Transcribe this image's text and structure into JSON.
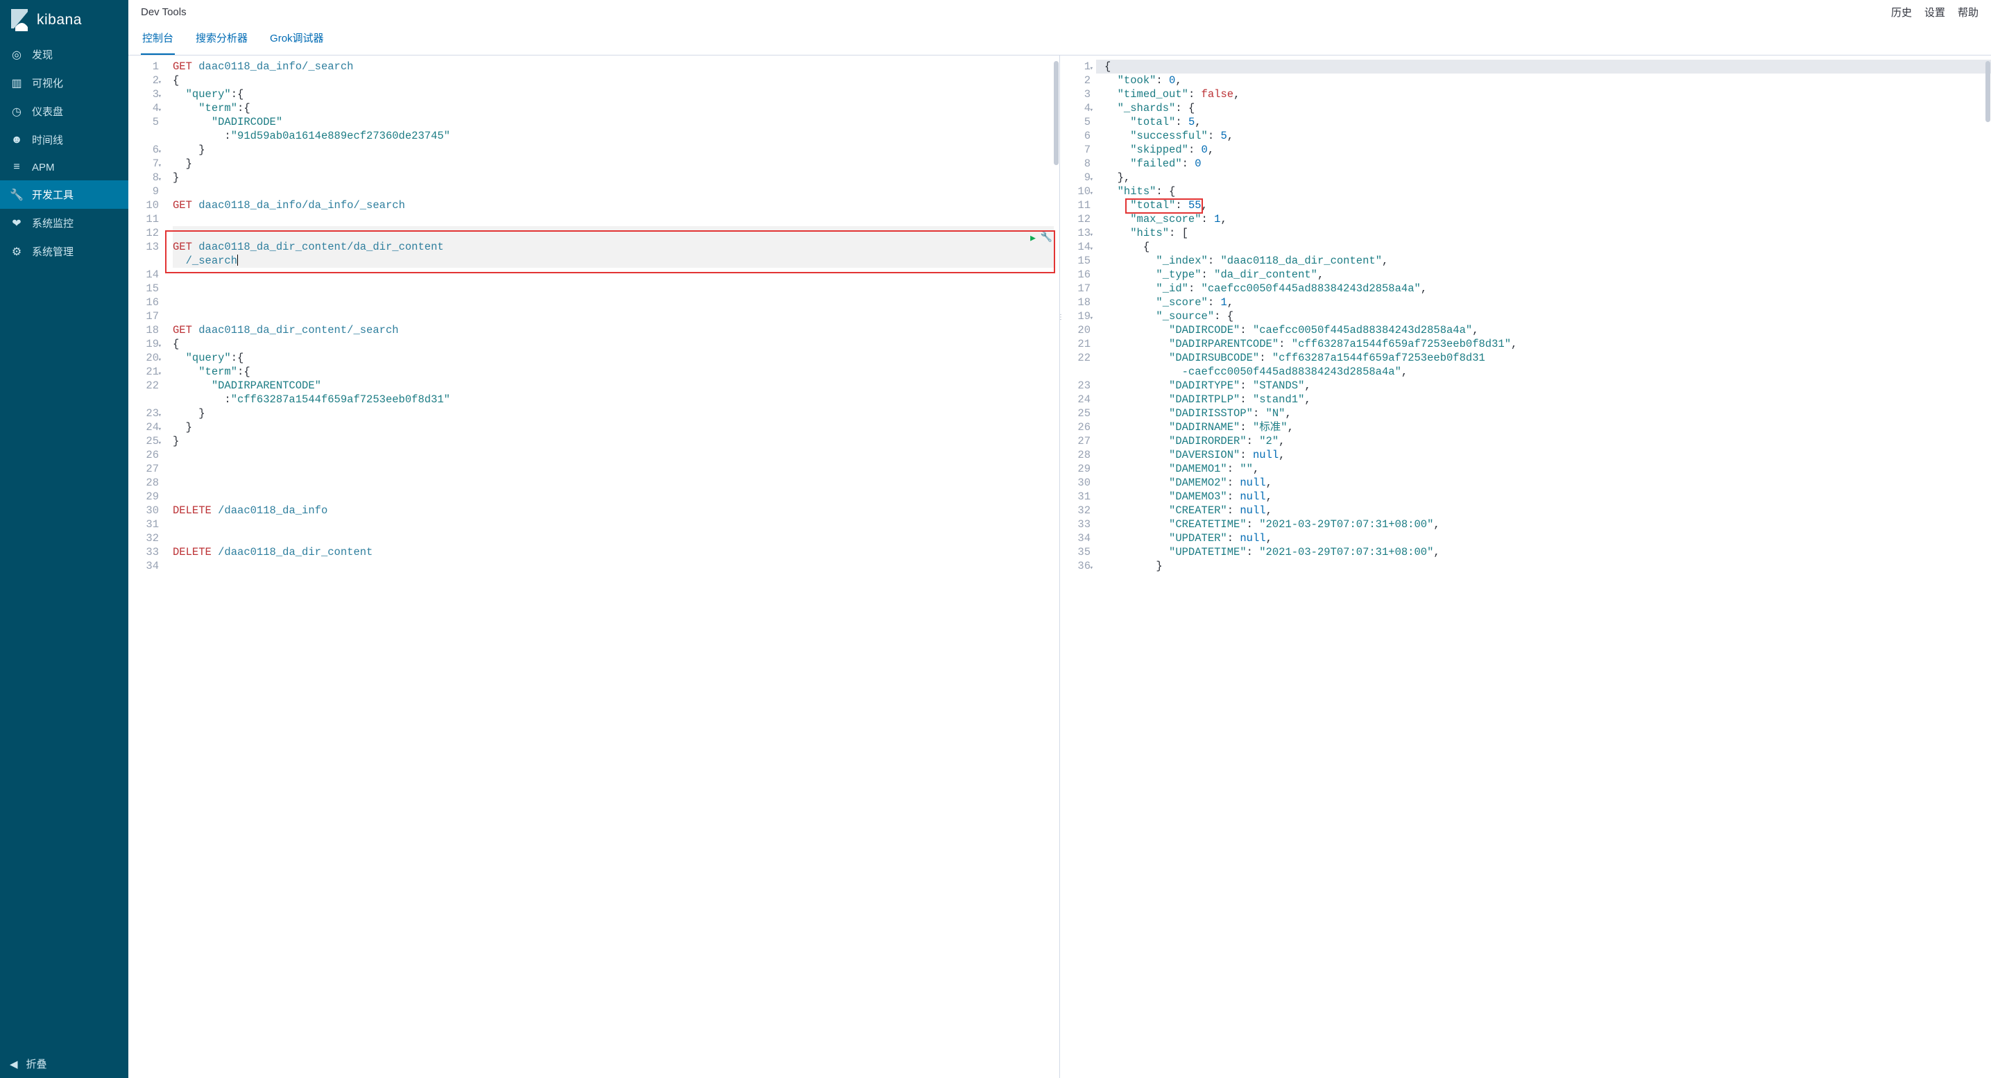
{
  "app_name": "kibana",
  "header": {
    "title": "Dev Tools"
  },
  "header_links": {
    "history": "历史",
    "settings": "设置",
    "help": "帮助"
  },
  "sidebar": {
    "items": [
      {
        "icon": "compass-icon",
        "label": "发现"
      },
      {
        "icon": "barchart-icon",
        "label": "可视化"
      },
      {
        "icon": "gauge-icon",
        "label": "仪表盘"
      },
      {
        "icon": "bear-icon",
        "label": "时间线"
      },
      {
        "icon": "apm-icon",
        "label": "APM"
      },
      {
        "icon": "wrench-icon",
        "label": "开发工具"
      },
      {
        "icon": "heartbeat-icon",
        "label": "系统监控"
      },
      {
        "icon": "gear-icon",
        "label": "系统管理"
      }
    ],
    "collapse_label": "折叠"
  },
  "tabs": [
    {
      "label": "控制台",
      "active": true
    },
    {
      "label": "搜索分析器",
      "active": false
    },
    {
      "label": "Grok调试器",
      "active": false
    }
  ],
  "editor": {
    "lines": [
      {
        "n": 1,
        "fold": false,
        "type": "req",
        "method": "GET",
        "path": "daac0118_da_info/_search"
      },
      {
        "n": 2,
        "fold": true,
        "type": "text",
        "text": "{"
      },
      {
        "n": 3,
        "fold": true,
        "type": "text",
        "text": "  \"query\":{"
      },
      {
        "n": 4,
        "fold": true,
        "type": "text",
        "text": "    \"term\":{"
      },
      {
        "n": 5,
        "fold": false,
        "type": "kv",
        "text": "      \"DADIRCODE\""
      },
      {
        "n": "",
        "fold": false,
        "type": "cont",
        "text": "        :\"91d59ab0a1614e889ecf27360de23745\""
      },
      {
        "n": 6,
        "fold": true,
        "type": "text",
        "text": "    }"
      },
      {
        "n": 7,
        "fold": true,
        "type": "text",
        "text": "  }"
      },
      {
        "n": 8,
        "fold": true,
        "type": "text",
        "text": "}"
      },
      {
        "n": 9,
        "fold": false,
        "type": "blank",
        "text": ""
      },
      {
        "n": 10,
        "fold": false,
        "type": "req",
        "method": "GET",
        "path": "daac0118_da_info/da_info/_search"
      },
      {
        "n": 11,
        "fold": false,
        "type": "blank",
        "text": ""
      },
      {
        "n": 12,
        "fold": false,
        "type": "blank",
        "text": "",
        "hl": true
      },
      {
        "n": 13,
        "fold": false,
        "type": "req",
        "method": "GET",
        "path": "daac0118_da_dir_content/da_dir_content",
        "hl": true
      },
      {
        "n": "",
        "fold": false,
        "type": "pathcont",
        "text": "/_search",
        "hl": true,
        "caret": true
      },
      {
        "n": 14,
        "fold": false,
        "type": "blank",
        "text": ""
      },
      {
        "n": 15,
        "fold": false,
        "type": "blank",
        "text": ""
      },
      {
        "n": 16,
        "fold": false,
        "type": "blank",
        "text": ""
      },
      {
        "n": 17,
        "fold": false,
        "type": "blank",
        "text": ""
      },
      {
        "n": 18,
        "fold": false,
        "type": "req",
        "method": "GET",
        "path": "daac0118_da_dir_content/_search"
      },
      {
        "n": 19,
        "fold": true,
        "type": "text",
        "text": "{"
      },
      {
        "n": 20,
        "fold": true,
        "type": "text",
        "text": "  \"query\":{"
      },
      {
        "n": 21,
        "fold": true,
        "type": "text",
        "text": "    \"term\":{"
      },
      {
        "n": 22,
        "fold": false,
        "type": "kv",
        "text": "      \"DADIRPARENTCODE\""
      },
      {
        "n": "",
        "fold": false,
        "type": "cont",
        "text": "        :\"cff63287a1544f659af7253eeb0f8d31\""
      },
      {
        "n": 23,
        "fold": true,
        "type": "text",
        "text": "    }"
      },
      {
        "n": 24,
        "fold": true,
        "type": "text",
        "text": "  }"
      },
      {
        "n": 25,
        "fold": true,
        "type": "text",
        "text": "}"
      },
      {
        "n": 26,
        "fold": false,
        "type": "blank",
        "text": ""
      },
      {
        "n": 27,
        "fold": false,
        "type": "blank",
        "text": ""
      },
      {
        "n": 28,
        "fold": false,
        "type": "blank",
        "text": ""
      },
      {
        "n": 29,
        "fold": false,
        "type": "blank",
        "text": ""
      },
      {
        "n": 30,
        "fold": false,
        "type": "req",
        "method": "DELETE",
        "path": "/daac0118_da_info"
      },
      {
        "n": 31,
        "fold": false,
        "type": "blank",
        "text": ""
      },
      {
        "n": 32,
        "fold": false,
        "type": "blank",
        "text": ""
      },
      {
        "n": 33,
        "fold": false,
        "type": "req",
        "method": "DELETE",
        "path": "/daac0118_da_dir_content"
      },
      {
        "n": 34,
        "fold": false,
        "type": "blank",
        "text": ""
      }
    ]
  },
  "response": {
    "lines": [
      {
        "n": 1,
        "fold": true,
        "t": [
          [
            "b",
            "{"
          ]
        ],
        "hl": true
      },
      {
        "n": 2,
        "fold": false,
        "t": [
          [
            "p",
            "  "
          ],
          [
            "k",
            "\"took\""
          ],
          [
            "c",
            ": "
          ],
          [
            "n",
            "0"
          ],
          [
            "p",
            ","
          ]
        ]
      },
      {
        "n": 3,
        "fold": false,
        "t": [
          [
            "p",
            "  "
          ],
          [
            "k",
            "\"timed_out\""
          ],
          [
            "c",
            ": "
          ],
          [
            "bo",
            "false"
          ],
          [
            "p",
            ","
          ]
        ]
      },
      {
        "n": 4,
        "fold": true,
        "t": [
          [
            "p",
            "  "
          ],
          [
            "k",
            "\"_shards\""
          ],
          [
            "c",
            ": "
          ],
          [
            "b",
            "{"
          ]
        ]
      },
      {
        "n": 5,
        "fold": false,
        "t": [
          [
            "p",
            "    "
          ],
          [
            "k",
            "\"total\""
          ],
          [
            "c",
            ": "
          ],
          [
            "n",
            "5"
          ],
          [
            "p",
            ","
          ]
        ]
      },
      {
        "n": 6,
        "fold": false,
        "t": [
          [
            "p",
            "    "
          ],
          [
            "k",
            "\"successful\""
          ],
          [
            "c",
            ": "
          ],
          [
            "n",
            "5"
          ],
          [
            "p",
            ","
          ]
        ]
      },
      {
        "n": 7,
        "fold": false,
        "t": [
          [
            "p",
            "    "
          ],
          [
            "k",
            "\"skipped\""
          ],
          [
            "c",
            ": "
          ],
          [
            "n",
            "0"
          ],
          [
            "p",
            ","
          ]
        ]
      },
      {
        "n": 8,
        "fold": false,
        "t": [
          [
            "p",
            "    "
          ],
          [
            "k",
            "\"failed\""
          ],
          [
            "c",
            ": "
          ],
          [
            "n",
            "0"
          ]
        ]
      },
      {
        "n": 9,
        "fold": true,
        "t": [
          [
            "p",
            "  "
          ],
          [
            "b",
            "},"
          ]
        ]
      },
      {
        "n": 10,
        "fold": true,
        "t": [
          [
            "p",
            "  "
          ],
          [
            "k",
            "\"hits\""
          ],
          [
            "c",
            ": "
          ],
          [
            "b",
            "{"
          ]
        ]
      },
      {
        "n": 11,
        "fold": false,
        "t": [
          [
            "p",
            "    "
          ],
          [
            "k",
            "\"total\""
          ],
          [
            "c",
            ": "
          ],
          [
            "n",
            "55"
          ],
          [
            "p",
            ","
          ]
        ]
      },
      {
        "n": 12,
        "fold": false,
        "t": [
          [
            "p",
            "    "
          ],
          [
            "k",
            "\"max_score\""
          ],
          [
            "c",
            ": "
          ],
          [
            "n",
            "1"
          ],
          [
            "p",
            ","
          ]
        ]
      },
      {
        "n": 13,
        "fold": true,
        "t": [
          [
            "p",
            "    "
          ],
          [
            "k",
            "\"hits\""
          ],
          [
            "c",
            ": "
          ],
          [
            "b",
            "["
          ]
        ]
      },
      {
        "n": 14,
        "fold": true,
        "t": [
          [
            "p",
            "      "
          ],
          [
            "b",
            "{"
          ]
        ]
      },
      {
        "n": 15,
        "fold": false,
        "t": [
          [
            "p",
            "        "
          ],
          [
            "k",
            "\"_index\""
          ],
          [
            "c",
            ": "
          ],
          [
            "s",
            "\"daac0118_da_dir_content\""
          ],
          [
            "p",
            ","
          ]
        ]
      },
      {
        "n": 16,
        "fold": false,
        "t": [
          [
            "p",
            "        "
          ],
          [
            "k",
            "\"_type\""
          ],
          [
            "c",
            ": "
          ],
          [
            "s",
            "\"da_dir_content\""
          ],
          [
            "p",
            ","
          ]
        ]
      },
      {
        "n": 17,
        "fold": false,
        "t": [
          [
            "p",
            "        "
          ],
          [
            "k",
            "\"_id\""
          ],
          [
            "c",
            ": "
          ],
          [
            "s",
            "\"caefcc0050f445ad88384243d2858a4a\""
          ],
          [
            "p",
            ","
          ]
        ]
      },
      {
        "n": 18,
        "fold": false,
        "t": [
          [
            "p",
            "        "
          ],
          [
            "k",
            "\"_score\""
          ],
          [
            "c",
            ": "
          ],
          [
            "n",
            "1"
          ],
          [
            "p",
            ","
          ]
        ]
      },
      {
        "n": 19,
        "fold": true,
        "t": [
          [
            "p",
            "        "
          ],
          [
            "k",
            "\"_source\""
          ],
          [
            "c",
            ": "
          ],
          [
            "b",
            "{"
          ]
        ]
      },
      {
        "n": 20,
        "fold": false,
        "t": [
          [
            "p",
            "          "
          ],
          [
            "k",
            "\"DADIRCODE\""
          ],
          [
            "c",
            ": "
          ],
          [
            "s",
            "\"caefcc0050f445ad88384243d2858a4a\""
          ],
          [
            "p",
            ","
          ]
        ]
      },
      {
        "n": 21,
        "fold": false,
        "t": [
          [
            "p",
            "          "
          ],
          [
            "k",
            "\"DADIRPARENTCODE\""
          ],
          [
            "c",
            ": "
          ],
          [
            "s",
            "\"cff63287a1544f659af7253eeb0f8d31\""
          ],
          [
            "p",
            ","
          ]
        ]
      },
      {
        "n": 22,
        "fold": false,
        "t": [
          [
            "p",
            "          "
          ],
          [
            "k",
            "\"DADIRSUBCODE\""
          ],
          [
            "c",
            ": "
          ],
          [
            "s",
            "\"cff63287a1544f659af7253eeb0f8d31"
          ]
        ]
      },
      {
        "n": "",
        "fold": false,
        "t": [
          [
            "p",
            "            "
          ],
          [
            "s",
            "-caefcc0050f445ad88384243d2858a4a\""
          ],
          [
            "p",
            ","
          ]
        ]
      },
      {
        "n": 23,
        "fold": false,
        "t": [
          [
            "p",
            "          "
          ],
          [
            "k",
            "\"DADIRTYPE\""
          ],
          [
            "c",
            ": "
          ],
          [
            "s",
            "\"STANDS\""
          ],
          [
            "p",
            ","
          ]
        ]
      },
      {
        "n": 24,
        "fold": false,
        "t": [
          [
            "p",
            "          "
          ],
          [
            "k",
            "\"DADIRTPLP\""
          ],
          [
            "c",
            ": "
          ],
          [
            "s",
            "\"stand1\""
          ],
          [
            "p",
            ","
          ]
        ]
      },
      {
        "n": 25,
        "fold": false,
        "t": [
          [
            "p",
            "          "
          ],
          [
            "k",
            "\"DADIRISSTOP\""
          ],
          [
            "c",
            ": "
          ],
          [
            "s",
            "\"N\""
          ],
          [
            "p",
            ","
          ]
        ]
      },
      {
        "n": 26,
        "fold": false,
        "t": [
          [
            "p",
            "          "
          ],
          [
            "k",
            "\"DADIRNAME\""
          ],
          [
            "c",
            ": "
          ],
          [
            "s",
            "\"标准\""
          ],
          [
            "p",
            ","
          ]
        ]
      },
      {
        "n": 27,
        "fold": false,
        "t": [
          [
            "p",
            "          "
          ],
          [
            "k",
            "\"DADIRORDER\""
          ],
          [
            "c",
            ": "
          ],
          [
            "s",
            "\"2\""
          ],
          [
            "p",
            ","
          ]
        ]
      },
      {
        "n": 28,
        "fold": false,
        "t": [
          [
            "p",
            "          "
          ],
          [
            "k",
            "\"DAVERSION\""
          ],
          [
            "c",
            ": "
          ],
          [
            "nl",
            "null"
          ],
          [
            "p",
            ","
          ]
        ]
      },
      {
        "n": 29,
        "fold": false,
        "t": [
          [
            "p",
            "          "
          ],
          [
            "k",
            "\"DAMEMO1\""
          ],
          [
            "c",
            ": "
          ],
          [
            "s",
            "\"\""
          ],
          [
            "p",
            ","
          ]
        ]
      },
      {
        "n": 30,
        "fold": false,
        "t": [
          [
            "p",
            "          "
          ],
          [
            "k",
            "\"DAMEMO2\""
          ],
          [
            "c",
            ": "
          ],
          [
            "nl",
            "null"
          ],
          [
            "p",
            ","
          ]
        ]
      },
      {
        "n": 31,
        "fold": false,
        "t": [
          [
            "p",
            "          "
          ],
          [
            "k",
            "\"DAMEMO3\""
          ],
          [
            "c",
            ": "
          ],
          [
            "nl",
            "null"
          ],
          [
            "p",
            ","
          ]
        ]
      },
      {
        "n": 32,
        "fold": false,
        "t": [
          [
            "p",
            "          "
          ],
          [
            "k",
            "\"CREATER\""
          ],
          [
            "c",
            ": "
          ],
          [
            "nl",
            "null"
          ],
          [
            "p",
            ","
          ]
        ]
      },
      {
        "n": 33,
        "fold": false,
        "t": [
          [
            "p",
            "          "
          ],
          [
            "k",
            "\"CREATETIME\""
          ],
          [
            "c",
            ": "
          ],
          [
            "s",
            "\"2021-03-29T07:07:31+08:00\""
          ],
          [
            "p",
            ","
          ]
        ]
      },
      {
        "n": 34,
        "fold": false,
        "t": [
          [
            "p",
            "          "
          ],
          [
            "k",
            "\"UPDATER\""
          ],
          [
            "c",
            ": "
          ],
          [
            "nl",
            "null"
          ],
          [
            "p",
            ","
          ]
        ]
      },
      {
        "n": 35,
        "fold": false,
        "t": [
          [
            "p",
            "          "
          ],
          [
            "k",
            "\"UPDATETIME\""
          ],
          [
            "c",
            ": "
          ],
          [
            "s",
            "\"2021-03-29T07:07:31+08:00\""
          ],
          [
            "p",
            ","
          ]
        ]
      },
      {
        "n": 36,
        "fold": true,
        "t": [
          [
            "p",
            "        "
          ],
          [
            "b",
            "}"
          ]
        ]
      }
    ]
  }
}
